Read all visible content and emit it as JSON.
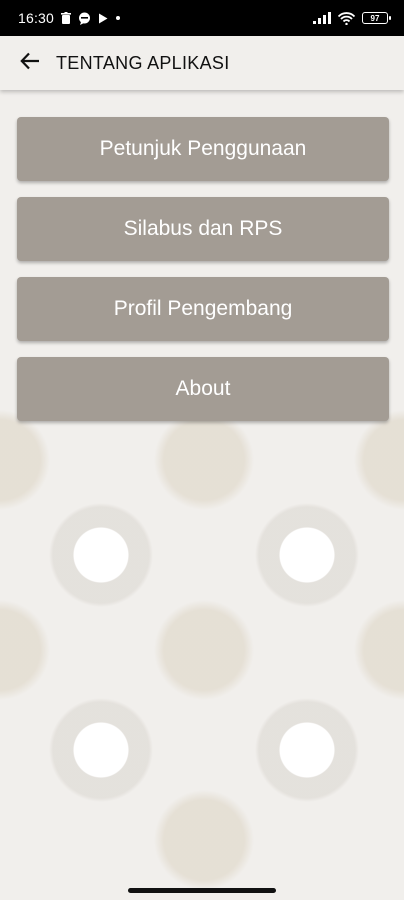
{
  "status_bar": {
    "time": "16:30",
    "battery": "97",
    "icons": [
      "trash-icon",
      "chat-bubble-icon",
      "play-icon",
      "dot-icon",
      "signal-icon",
      "wifi-icon",
      "battery-icon"
    ]
  },
  "app_bar": {
    "title": "TENTANG APLIKASI",
    "back_icon": "arrow-left-icon"
  },
  "menu": {
    "items": [
      {
        "label": "Petunjuk Penggunaan"
      },
      {
        "label": "Silabus dan RPS"
      },
      {
        "label": "Profil Pengembang"
      },
      {
        "label": "About"
      }
    ]
  },
  "colors": {
    "button_bg": "#a39c94",
    "button_text": "#ffffff",
    "background": "#f1efec",
    "status_bar": "#000000"
  }
}
